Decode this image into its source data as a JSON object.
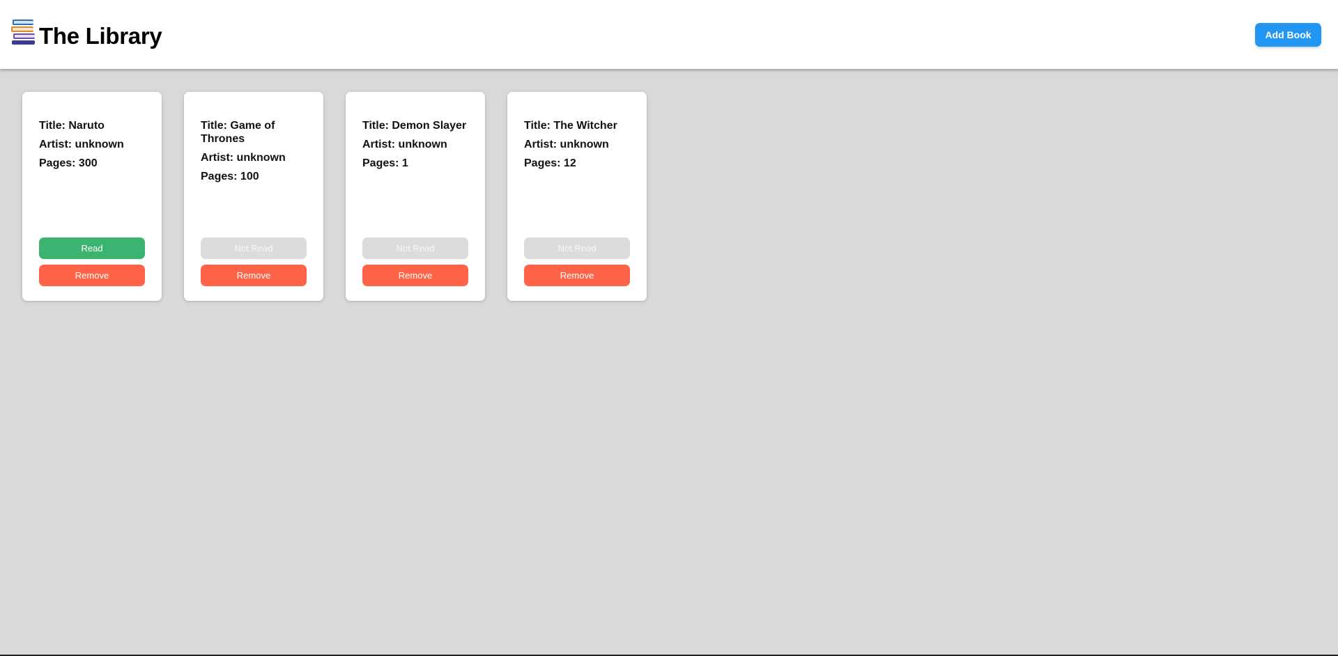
{
  "header": {
    "title": "The Library",
    "add_book_label": "Add Book",
    "logo_icon": "books-icon"
  },
  "colors": {
    "header_bg": "#ffffff",
    "page_bg": "#d9d9d9",
    "add_button": "#2196f3",
    "read": "#3cb371",
    "not_read": "#dcdcdc",
    "remove": "#ff6347"
  },
  "books": [
    {
      "title": "Title: Naruto",
      "artist": "Artist: unknown",
      "pages": "Pages: 300",
      "status_label": "Read",
      "is_read": true,
      "remove_label": "Remove"
    },
    {
      "title": "Title: Game of Thrones",
      "artist": "Artist: unknown",
      "pages": "Pages: 100",
      "status_label": "Not Read",
      "is_read": false,
      "remove_label": "Remove"
    },
    {
      "title": "Title: Demon Slayer",
      "artist": "Artist: unknown",
      "pages": "Pages: 1",
      "status_label": "Not Read",
      "is_read": false,
      "remove_label": "Remove"
    },
    {
      "title": "Title: The Witcher",
      "artist": "Artist: unknown",
      "pages": "Pages: 12",
      "status_label": "Not Read",
      "is_read": false,
      "remove_label": "Remove"
    }
  ]
}
